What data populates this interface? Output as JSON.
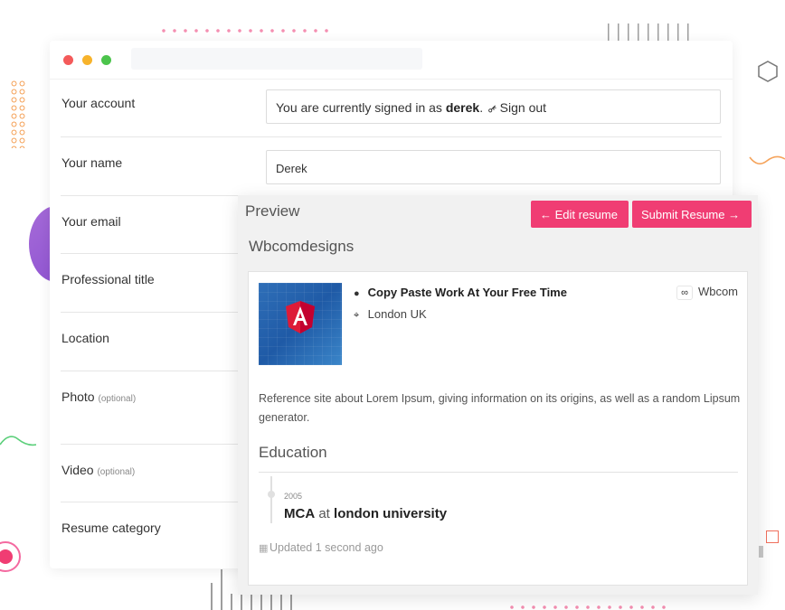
{
  "form": {
    "rows": [
      {
        "label": "Your account",
        "optional": ""
      },
      {
        "label": "Your name",
        "optional": ""
      },
      {
        "label": "Your email",
        "optional": ""
      },
      {
        "label": "Professional title",
        "optional": ""
      },
      {
        "label": "Location",
        "optional": ""
      },
      {
        "label": "Photo",
        "optional": "(optional)"
      },
      {
        "label": "Video",
        "optional": "(optional)"
      },
      {
        "label": "Resume category",
        "optional": ""
      }
    ],
    "account_text_prefix": "You are currently signed in as",
    "account_username": "derek",
    "account_text_suffix": ".",
    "sign_out_label": "Sign out",
    "name_value": "Derek"
  },
  "preview": {
    "title": "Preview",
    "edit_button": "← Edit resume",
    "submit_button": "Submit Resume →",
    "company_heading": "Wbcomdesigns",
    "job_title": "Copy Paste Work At Your Free Time",
    "location": "London UK",
    "company_link": "Wbcom",
    "description": "Reference site about Lorem Ipsum, giving information on its origins, as well as a random Lipsum generator.",
    "education_heading": "Education",
    "education": {
      "year": "2005",
      "qualification": "MCA",
      "connector": "at",
      "school": "london university"
    },
    "updated": "Updated 1 second ago"
  },
  "icons": {
    "key": "key-icon",
    "user": "user-icon",
    "pin": "map-pin-icon",
    "link": "link-icon",
    "calendar": "calendar-icon",
    "thumbnail_logo": "angular-logo-icon"
  },
  "colors": {
    "accent": "#f03d73",
    "window_red": "#f45a5a",
    "window_yellow": "#f7b32b",
    "window_green": "#4cc44c"
  }
}
